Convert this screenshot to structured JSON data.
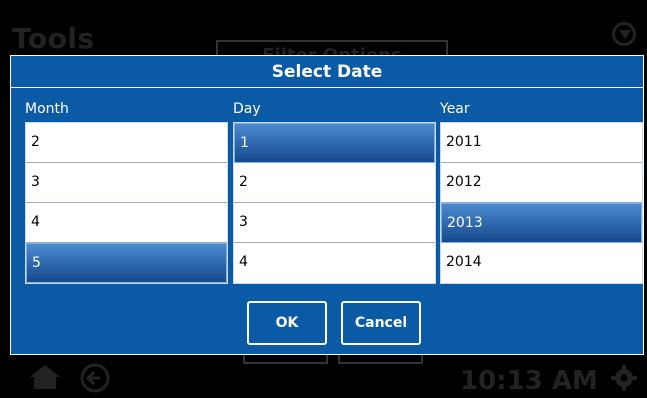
{
  "background": {
    "title": "Tools",
    "filter_button_label": "Filter Options",
    "time": "10:13 AM"
  },
  "dialog": {
    "title": "Select Date",
    "columns": [
      {
        "label": "Month",
        "items": [
          "2",
          "3",
          "4",
          "5"
        ],
        "selected": "5"
      },
      {
        "label": "Day",
        "items": [
          "1",
          "2",
          "3",
          "4"
        ],
        "selected": "1"
      },
      {
        "label": "Year",
        "items": [
          "2011",
          "2012",
          "2013",
          "2014"
        ],
        "selected": "2013"
      }
    ],
    "ok_label": "OK",
    "cancel_label": "Cancel"
  },
  "colors": {
    "dialog_bg": "#0a5aa6",
    "selected_bg": "#2d66ad",
    "background": "#000000"
  },
  "icons": [
    "filter-icon",
    "home-icon",
    "back-icon",
    "gear-icon"
  ]
}
